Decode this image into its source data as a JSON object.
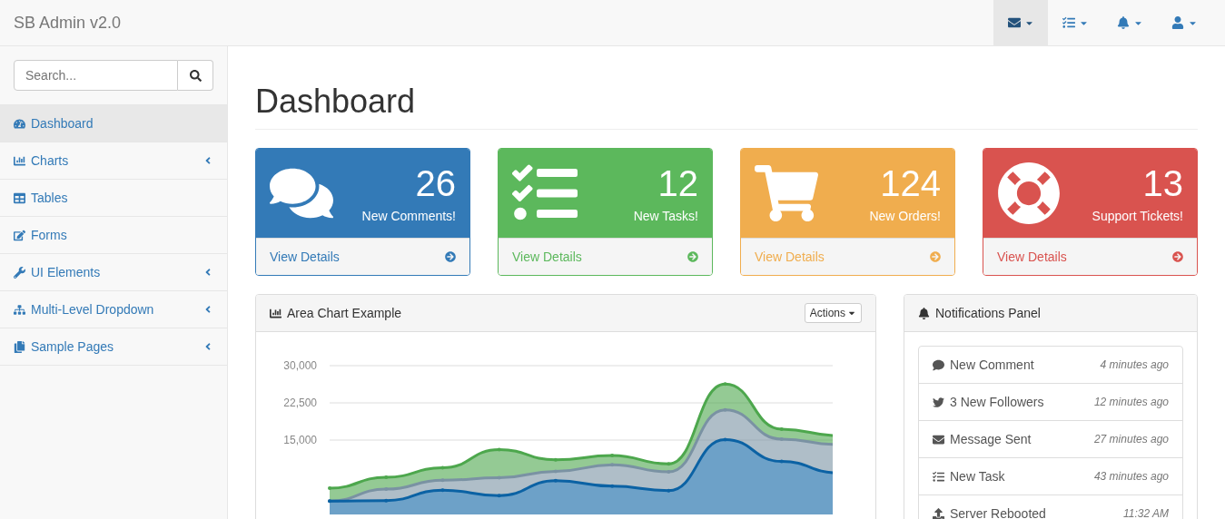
{
  "navbar": {
    "brand": "SB Admin v2.0",
    "menus": [
      {
        "selected": true
      },
      {
        "selected": false
      },
      {
        "selected": false
      },
      {
        "selected": false
      }
    ]
  },
  "sidebar": {
    "search": {
      "placeholder": "Search..."
    },
    "items": [
      {
        "label": "Dashboard",
        "selected": true,
        "has_submenu": false
      },
      {
        "label": "Charts",
        "selected": false,
        "has_submenu": true
      },
      {
        "label": "Tables",
        "selected": false,
        "has_submenu": false
      },
      {
        "label": "Forms",
        "selected": false,
        "has_submenu": false
      },
      {
        "label": "UI Elements",
        "selected": false,
        "has_submenu": true
      },
      {
        "label": "Multi-Level Dropdown",
        "selected": false,
        "has_submenu": true
      },
      {
        "label": "Sample Pages",
        "selected": false,
        "has_submenu": true
      }
    ]
  },
  "page_title": "Dashboard",
  "cards": [
    {
      "count": "26",
      "label": "New Comments!",
      "link": "View Details",
      "color": "#337ab7"
    },
    {
      "count": "12",
      "label": "New Tasks!",
      "link": "View Details",
      "color": "#5cb85c"
    },
    {
      "count": "124",
      "label": "New Orders!",
      "link": "View Details",
      "color": "#f0ad4e"
    },
    {
      "count": "13",
      "label": "Support Tickets!",
      "link": "View Details",
      "color": "#d9534f"
    }
  ],
  "chart_panel": {
    "title": "Area Chart Example",
    "actions": "Actions",
    "chart_data": {
      "type": "area",
      "stacked": true,
      "ylim": [
        0,
        30000
      ],
      "yticks": [
        {
          "value": 15000,
          "label": "15,000"
        },
        {
          "value": 22500,
          "label": "22,500"
        },
        {
          "value": 30000,
          "label": "30,000"
        }
      ],
      "series": [
        {
          "color": "#0b62a4",
          "values": [
            2700,
            2800,
            4900,
            3800,
            6800,
            5700,
            4800,
            15100,
            10700,
            8400
          ]
        },
        {
          "color": "#7a92a3",
          "values": [
            0,
            2300,
            2000,
            3600,
            1900,
            4300,
            3800,
            6000,
            4500,
            5700
          ]
        },
        {
          "color": "#4da74d",
          "values": [
            2600,
            2400,
            2500,
            5700,
            2300,
            1900,
            1600,
            5200,
            2000,
            1800
          ]
        }
      ]
    }
  },
  "notifications_panel": {
    "title": "Notifications Panel",
    "items": [
      {
        "text": "New Comment",
        "time": "4 minutes ago"
      },
      {
        "text": "3 New Followers",
        "time": "12 minutes ago"
      },
      {
        "text": "Message Sent",
        "time": "27 minutes ago"
      },
      {
        "text": "New Task",
        "time": "43 minutes ago"
      },
      {
        "text": "Server Rebooted",
        "time": "11:32 AM"
      }
    ]
  }
}
